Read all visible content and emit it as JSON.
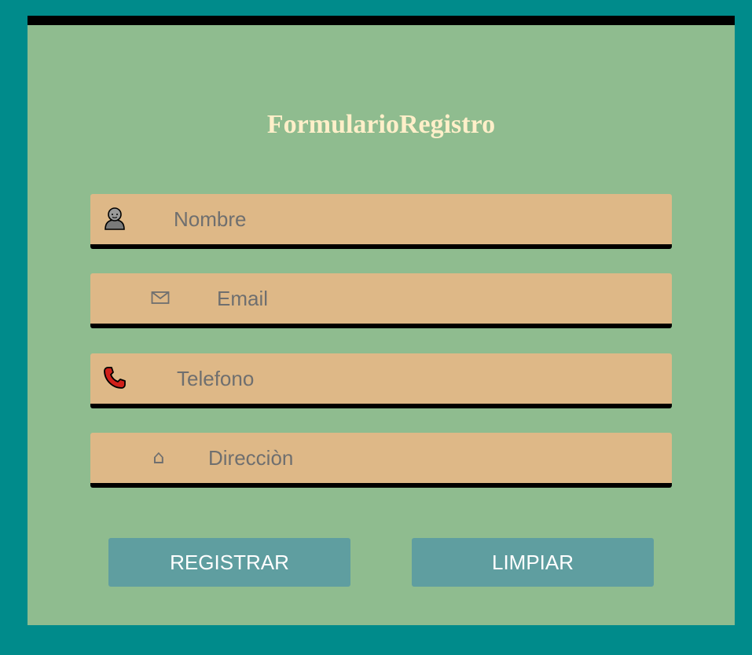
{
  "form": {
    "title": "FormularioRegistro",
    "fields": [
      {
        "icon": "person-icon",
        "placeholder": "Nombre",
        "value": ""
      },
      {
        "icon": "envelope-icon",
        "placeholder": "Email",
        "value": ""
      },
      {
        "icon": "telephone-icon",
        "placeholder": "Telefono",
        "value": ""
      },
      {
        "icon": "house-icon",
        "placeholder": "Direcciòn",
        "value": ""
      }
    ],
    "buttons": {
      "register_label": "REGISTRAR",
      "clear_label": "LIMPIAR"
    }
  },
  "colors": {
    "background": "#008b8b",
    "panel": "#8fbc8f",
    "field": "#deb887",
    "button": "#5f9ea0",
    "title": "#ffefc9"
  }
}
